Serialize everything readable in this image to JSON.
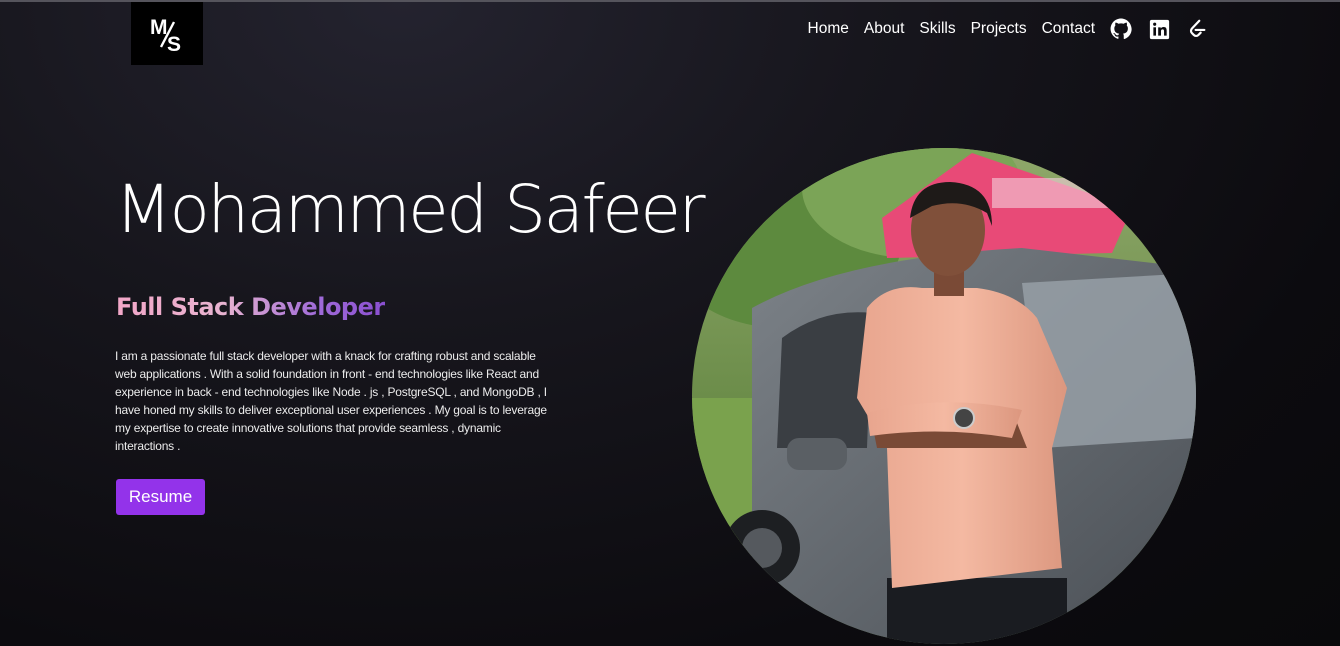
{
  "logo": {
    "text": "M/S",
    "icon": "ms-monogram-logo"
  },
  "nav": {
    "items": [
      "Home",
      "About",
      "Skills",
      "Projects",
      "Contact"
    ],
    "icons": [
      "github-icon",
      "linkedin-icon",
      "leetcode-icon"
    ]
  },
  "hero": {
    "name": "Mohammed Safeer",
    "role": "Full Stack Developer",
    "bio": "I am a passionate full stack developer with a knack for crafting robust and scalable web applications . With a solid foundation in front - end technologies like React and experience in back - end technologies like Node . js , PostgreSQL , and MongoDB , I have honed my skills to deliver exceptional user experiences . My goal is to leverage my expertise to create innovative solutions that provide seamless , dynamic interactions .",
    "resume_label": "Resume"
  },
  "colors": {
    "accent": "#9333ea",
    "role_gradient_start": "#f2a7c8",
    "role_gradient_end": "#8a4fd0",
    "background": "#0c0b0f"
  }
}
